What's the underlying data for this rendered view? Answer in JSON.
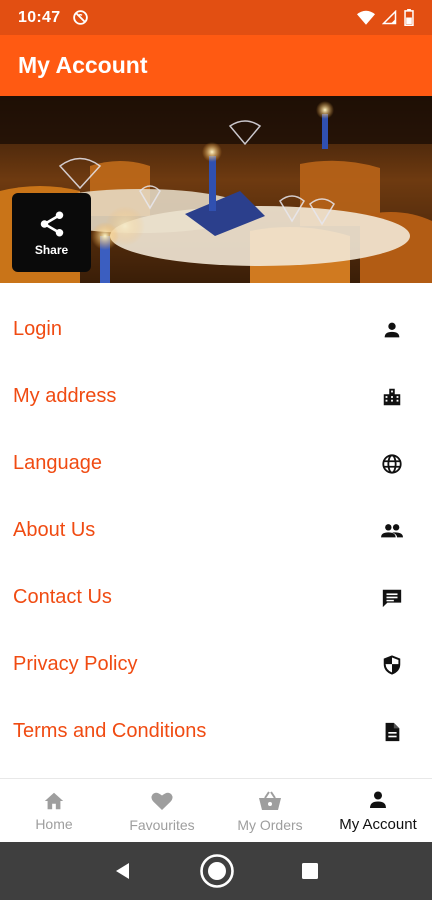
{
  "status_bar": {
    "time": "10:47"
  },
  "app_bar": {
    "title": "My Account"
  },
  "share": {
    "label": "Share"
  },
  "menu": {
    "items": [
      {
        "label": "Login",
        "icon": "person-icon"
      },
      {
        "label": "My address",
        "icon": "building-icon"
      },
      {
        "label": "Language",
        "icon": "globe-icon"
      },
      {
        "label": "About Us",
        "icon": "people-icon"
      },
      {
        "label": "Contact Us",
        "icon": "chat-icon"
      },
      {
        "label": "Privacy Policy",
        "icon": "shield-icon"
      },
      {
        "label": "Terms and Conditions",
        "icon": "document-icon"
      }
    ]
  },
  "bottom_nav": {
    "items": [
      {
        "label": "Home",
        "icon": "home-icon",
        "active": false
      },
      {
        "label": "Favourites",
        "icon": "heart-icon",
        "active": false
      },
      {
        "label": "My Orders",
        "icon": "basket-icon",
        "active": false
      },
      {
        "label": "My Account",
        "icon": "person-icon",
        "active": true
      }
    ]
  },
  "colors": {
    "status_bar": "#e24f12",
    "app_bar": "#ff5a12",
    "menu_text": "#f04b12",
    "nav_inactive": "#9e9e9e",
    "nav_active": "#111111",
    "system_nav": "#3f3f3f"
  }
}
